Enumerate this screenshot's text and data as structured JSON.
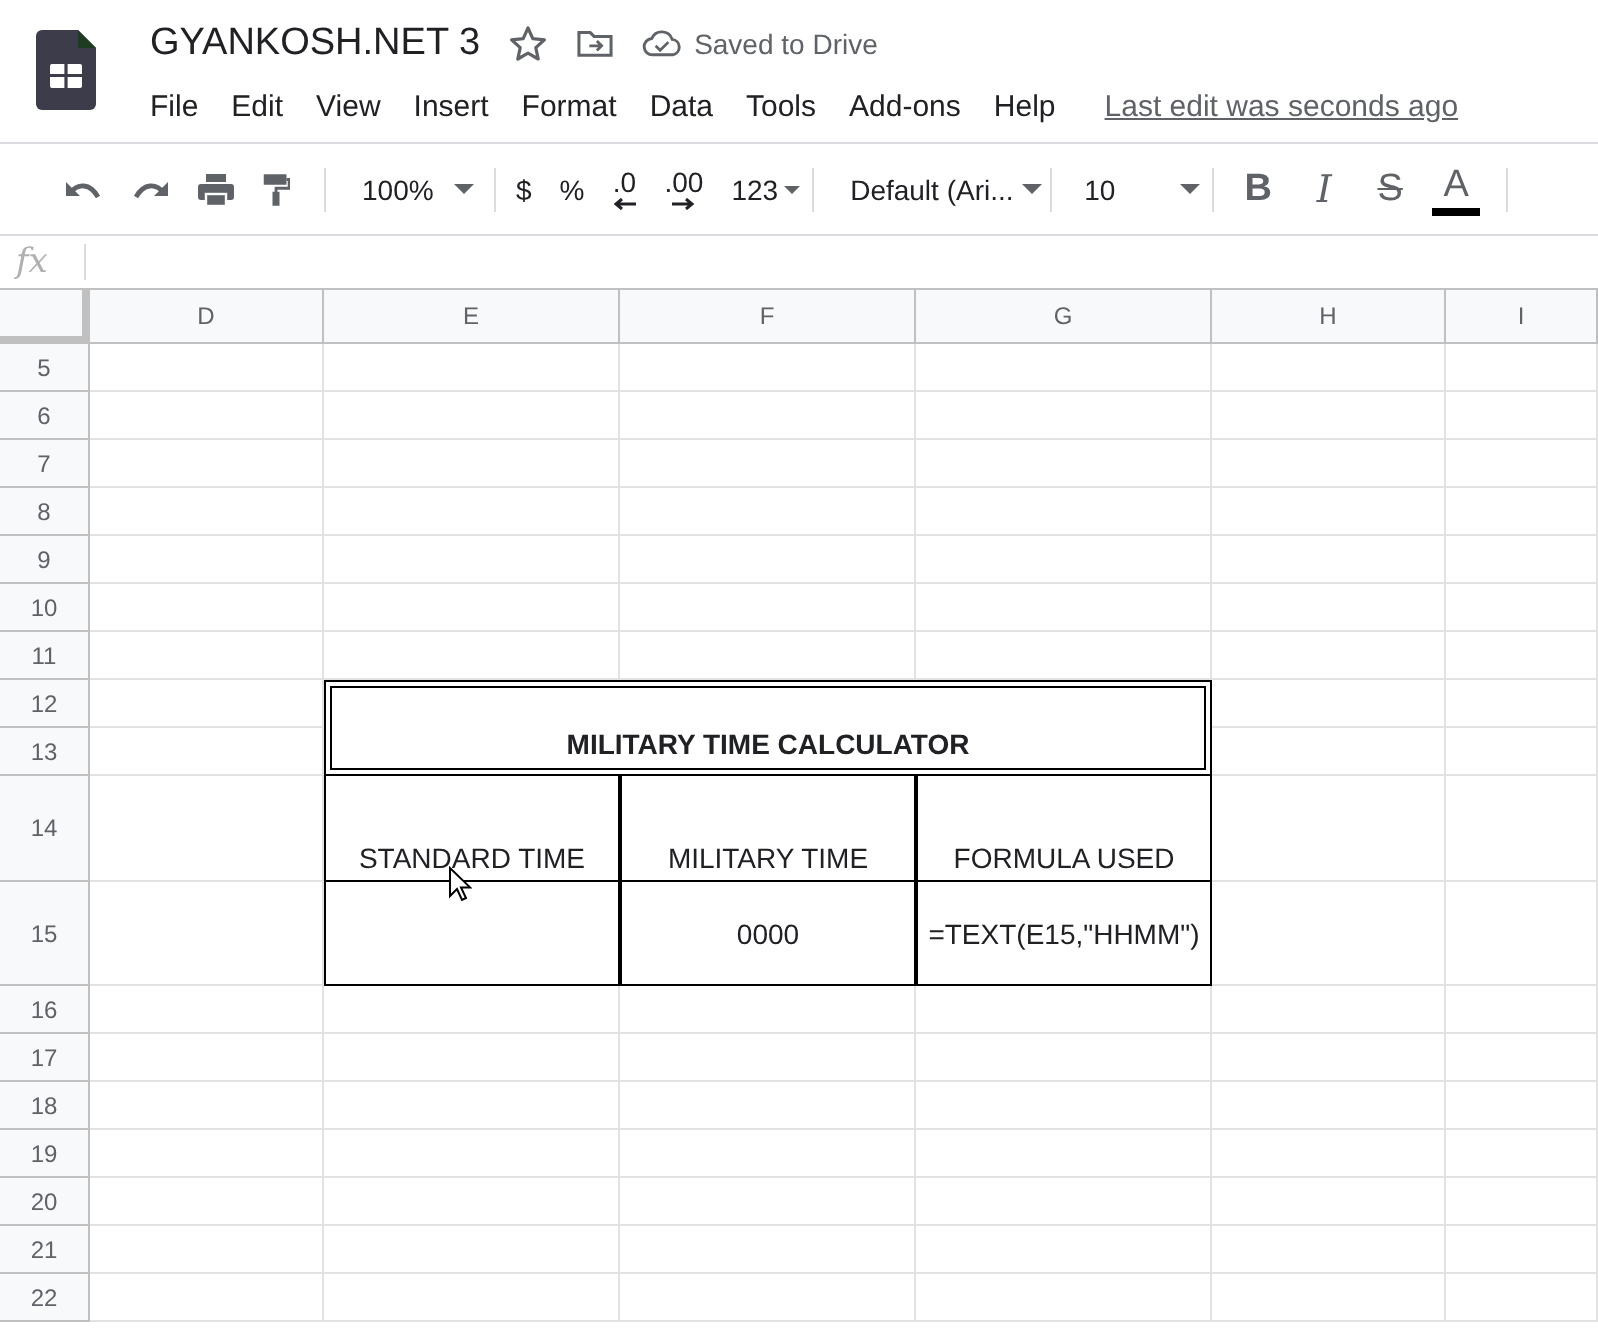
{
  "document": {
    "title": "GYANKOSH.NET 3",
    "save_status": "Saved to Drive"
  },
  "menu": [
    "File",
    "Edit",
    "View",
    "Insert",
    "Format",
    "Data",
    "Tools",
    "Add-ons",
    "Help"
  ],
  "last_edit": "Last edit was seconds ago",
  "toolbar": {
    "zoom": "100%",
    "number_formats": [
      {
        "label": "$",
        "kind": "plain"
      },
      {
        "label": "%",
        "kind": "plain"
      },
      {
        "label": ".0",
        "kind": "decrease"
      },
      {
        "label": ".00",
        "kind": "increase"
      },
      {
        "label": "123",
        "kind": "menu"
      }
    ],
    "font": "Default (Ari...",
    "font_size": "10",
    "text_styles": [
      {
        "label": "B",
        "kind": "bold"
      },
      {
        "label": "I",
        "kind": "italic"
      },
      {
        "label": "S",
        "kind": "strike"
      },
      {
        "label": "A",
        "kind": "color"
      }
    ]
  },
  "formula_bar": {
    "label": "fx"
  },
  "sheet": {
    "columns": [
      "D",
      "E",
      "F",
      "G",
      "H",
      "I"
    ],
    "rows": [
      "5",
      "6",
      "7",
      "8",
      "9",
      "10",
      "11",
      "12",
      "13",
      "14",
      "15",
      "16",
      "17",
      "18",
      "19",
      "20",
      "21",
      "22"
    ]
  },
  "calculator": {
    "title": "MILITARY TIME CALCULATOR",
    "headers": [
      "STANDARD TIME",
      "MILITARY TIME",
      "FORMULA USED"
    ],
    "values": [
      {
        "kind": "empty"
      },
      {
        "kind": "text",
        "text": "0000"
      },
      {
        "kind": "text",
        "text": "=TEXT(E15,\"HHMM\")"
      }
    ]
  }
}
